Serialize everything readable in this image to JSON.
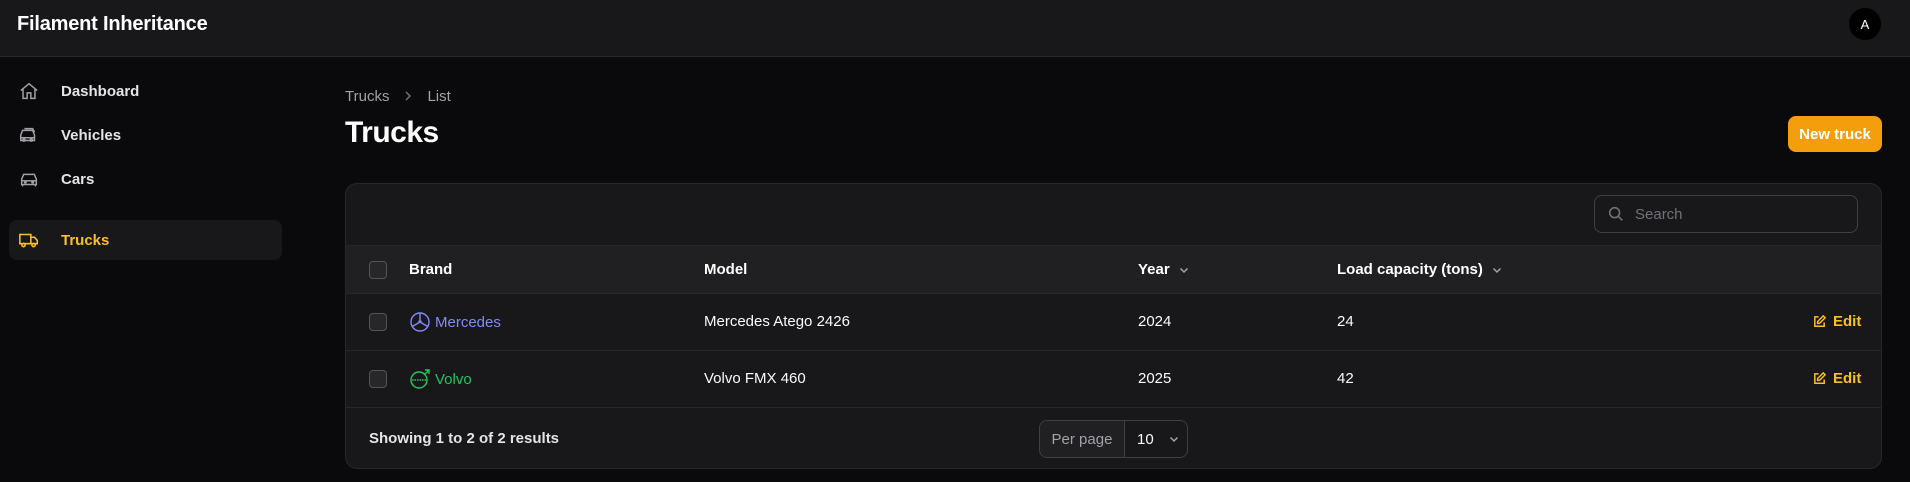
{
  "app": {
    "title": "Filament Inheritance",
    "avatar_initial": "A"
  },
  "sidebar": {
    "items": [
      {
        "label": "Dashboard",
        "icon": "home-icon",
        "active": false
      },
      {
        "label": "Vehicles",
        "icon": "vehicles-icon",
        "active": false
      },
      {
        "label": "Cars",
        "icon": "car-icon",
        "active": false
      },
      {
        "label": "Trucks",
        "icon": "truck-icon",
        "active": true
      }
    ]
  },
  "breadcrumb": {
    "items": [
      "Trucks",
      "List"
    ],
    "separator_icon": "chevron-right-icon"
  },
  "page": {
    "title": "Trucks",
    "new_button_label": "New truck"
  },
  "search": {
    "placeholder": "Search",
    "value": "",
    "icon": "search-icon"
  },
  "table": {
    "columns": [
      {
        "label": "Brand",
        "sortable": false
      },
      {
        "label": "Model",
        "sortable": false
      },
      {
        "label": "Year",
        "sortable": true
      },
      {
        "label": "Load capacity (tons)",
        "sortable": true
      }
    ],
    "rows": [
      {
        "brand": "Mercedes",
        "brand_icon": "mercedes-star-icon",
        "brand_color": "#818cf8",
        "model": "Mercedes Atego 2426",
        "year": "2024",
        "load_capacity": "24",
        "action": "Edit"
      },
      {
        "brand": "Volvo",
        "brand_icon": "volvo-logo-icon",
        "brand_color": "#22c55e",
        "model": "Volvo FMX 460",
        "year": "2025",
        "load_capacity": "42",
        "action": "Edit"
      }
    ]
  },
  "pagination": {
    "summary": "Showing 1 to 2 of 2 results",
    "per_page_label": "Per page",
    "per_page_value": "10"
  },
  "colors": {
    "accent": "#f59e0b",
    "active_nav": "#fbbf24",
    "background": "#0a0a0c",
    "panel": "#18181b"
  }
}
